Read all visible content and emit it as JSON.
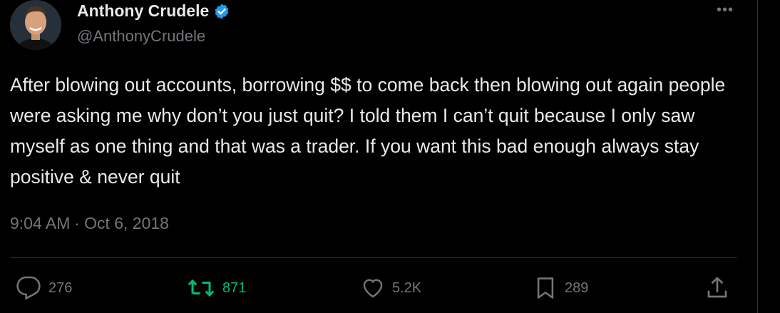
{
  "tweet": {
    "author": {
      "display_name": "Anthony Crudele",
      "handle": "@AnthonyCrudele",
      "verified_icon": "verified-badge-icon",
      "avatar": "avatar-photo"
    },
    "more_icon": "more-options-icon",
    "text": "After blowing out accounts, borrowing $$ to come back then blowing out again people were asking me why don’t you just quit? I told them I can’t quit because I only saw myself as one thing and that was a trader. If you want this bad enough always stay positive & never quit",
    "time": "9:04 AM",
    "separator": "·",
    "date": "Oct 6, 2018"
  },
  "actions": {
    "replies": {
      "icon": "reply-icon",
      "count": "276"
    },
    "retweets": {
      "icon": "retweet-icon",
      "count": "871",
      "color": "#00ba7c"
    },
    "likes": {
      "icon": "heart-icon",
      "count": "5.2K"
    },
    "bookmarks": {
      "icon": "bookmark-icon",
      "count": "289"
    },
    "share": {
      "icon": "share-icon"
    }
  },
  "colors": {
    "background": "#000000",
    "text_primary": "#e7e9ea",
    "text_secondary": "#71767b",
    "verified_blue": "#1d9bf0",
    "divider": "#2f3336"
  }
}
